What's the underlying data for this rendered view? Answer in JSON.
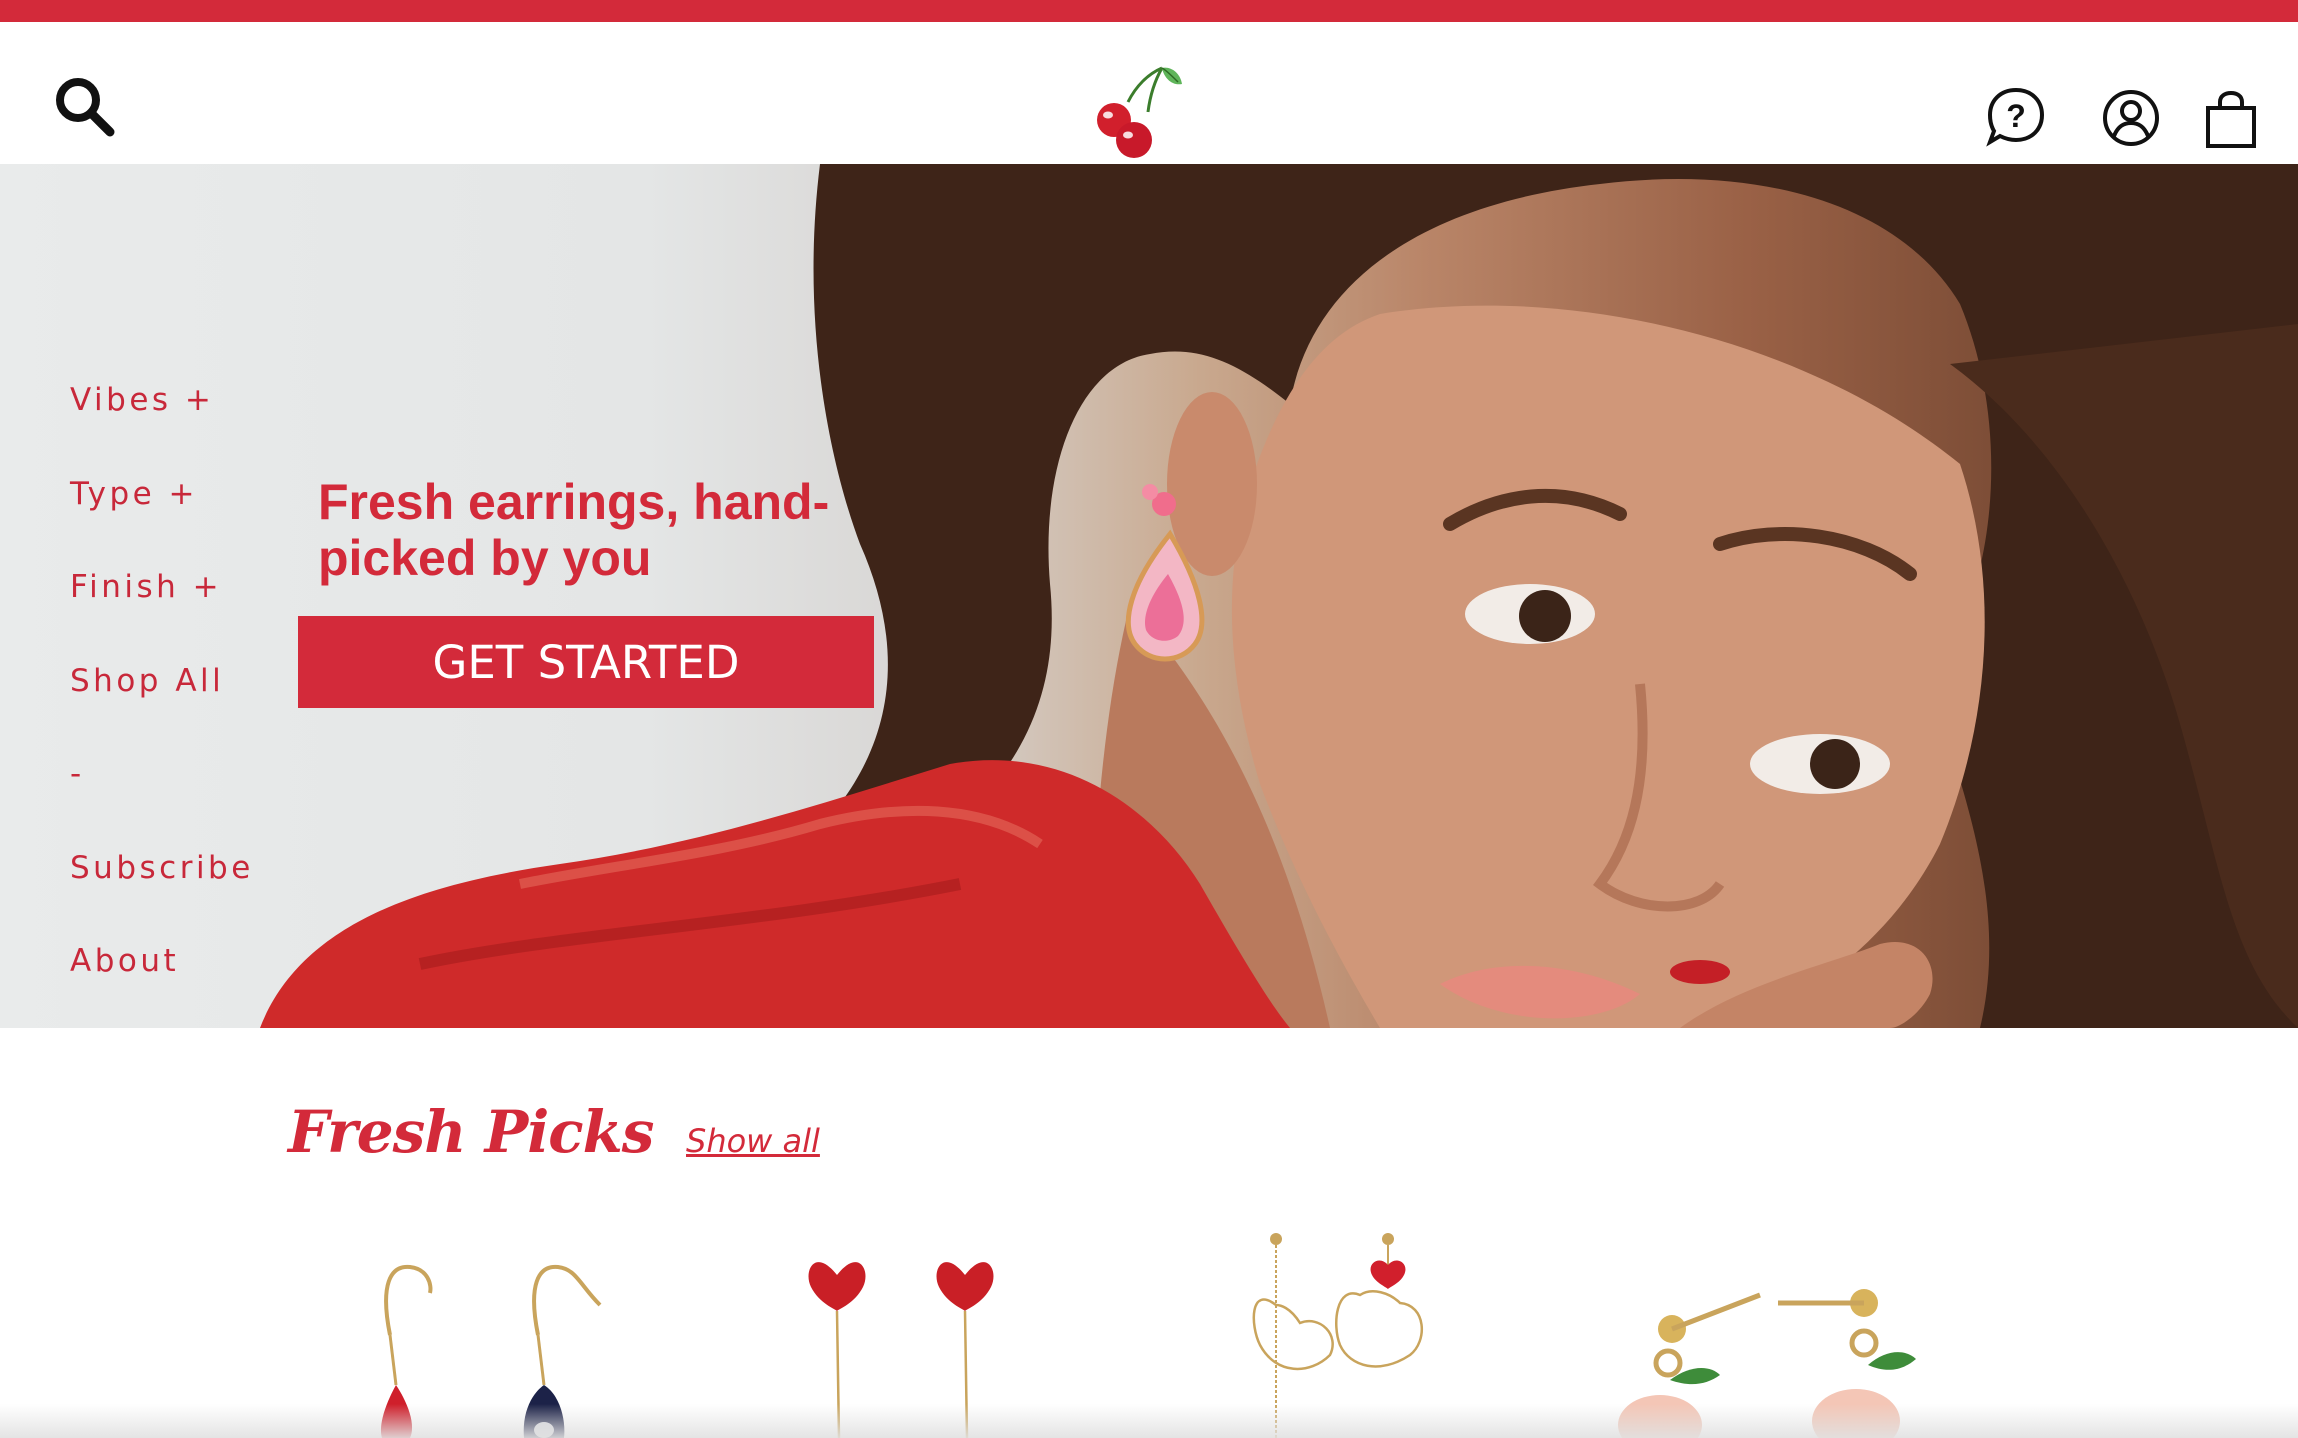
{
  "header": {
    "icons": {
      "search": "search-icon",
      "logo": "cherry-logo",
      "help": "help-chat-icon",
      "account": "user-account-icon",
      "cart": "shopping-bag-icon"
    }
  },
  "nav": {
    "items": [
      {
        "label": "Vibes +"
      },
      {
        "label": "Type +"
      },
      {
        "label": "Finish +"
      },
      {
        "label": "Shop All"
      },
      {
        "label": "-"
      },
      {
        "label": "Subscribe"
      },
      {
        "label": "About"
      }
    ]
  },
  "hero": {
    "headline": "Fresh earrings, hand-picked by you",
    "cta_label": "GET STARTED"
  },
  "fresh_picks": {
    "title": "Fresh Picks",
    "show_all_label": "Show all",
    "products": [
      {
        "image": "red-and-navy-drop-earrings"
      },
      {
        "image": "red-heart-threader-earrings"
      },
      {
        "image": "gold-wire-heart-earrings"
      },
      {
        "image": "peach-charm-earrings"
      }
    ]
  },
  "colors": {
    "brand_red": "#d32a3a",
    "background": "#ffffff",
    "icon_black": "#111111"
  }
}
